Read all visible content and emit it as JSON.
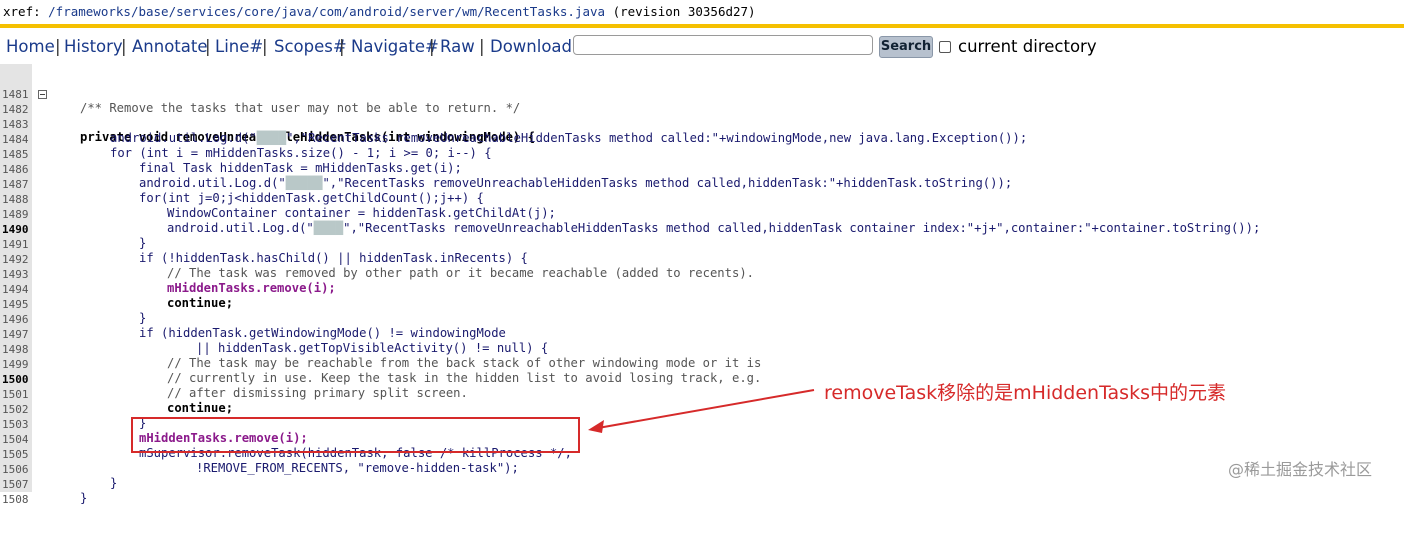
{
  "xref": {
    "prefix": "xref: ",
    "path": "/frameworks/base/services/core/java/com/android/server/wm/RecentTasks.java",
    "revision": " (revision 30356d27)"
  },
  "nav": {
    "items": [
      "Home",
      "History",
      "Annotate",
      "Line#",
      "Scopes#",
      "Navigate#",
      "Raw",
      "Download"
    ],
    "search_placeholder": "",
    "search_button": "Search",
    "checkbox_label": "current directory"
  },
  "code": {
    "lines": [
      {
        "n": "1481",
        "t": "/** Remove the tasks that user may not be able to return. */"
      },
      {
        "n": "1482",
        "t": "private void removeUnreachableHiddenTasks(int windowingMode) {"
      },
      {
        "n": "1483",
        "t": "android.util.Log.d(\"",
        "t2": "\",\"RecentTasks removeUnreachableHiddenTasks method called:\"+windowingMode,new java.lang.Exception());"
      },
      {
        "n": "1484",
        "t": "for (int i = mHiddenTasks.size() - 1; i >= 0; i--) {"
      },
      {
        "n": "1485",
        "t": "final Task hiddenTask = mHiddenTasks.get(i);"
      },
      {
        "n": "1486",
        "t": "android.util.Log.d(\"",
        "t2": "\",\"RecentTasks removeUnreachableHiddenTasks method called,hiddenTask:\"+hiddenTask.toString());"
      },
      {
        "n": "1487",
        "t": "for(int j=0;j<hiddenTask.getChildCount();j++) {"
      },
      {
        "n": "1488",
        "t": "WindowContainer container = hiddenTask.getChildAt(j);"
      },
      {
        "n": "1489",
        "t": "android.util.Log.d(\"",
        "t2": "\",\"RecentTasks removeUnreachableHiddenTasks method called,hiddenTask container index:\"+j+\",container:\"+container.toString());"
      },
      {
        "n": "1490",
        "t": "}"
      },
      {
        "n": "1491",
        "t": "if (!hiddenTask.hasChild() || hiddenTask.inRecents) {"
      },
      {
        "n": "1492",
        "t": "// The task was removed by other path or it became reachable (added to recents)."
      },
      {
        "n": "1493",
        "t": "mHiddenTasks.remove(i);"
      },
      {
        "n": "1494",
        "t": "continue;"
      },
      {
        "n": "1495",
        "t": "}"
      },
      {
        "n": "1496",
        "t": "if (hiddenTask.getWindowingMode() != windowingMode"
      },
      {
        "n": "1497",
        "t": "|| hiddenTask.getTopVisibleActivity() != null) {"
      },
      {
        "n": "1498",
        "t": "// The task may be reachable from the back stack of other windowing mode or it is"
      },
      {
        "n": "1499",
        "t": "// currently in use. Keep the task in the hidden list to avoid losing track, e.g."
      },
      {
        "n": "1500",
        "t": "// after dismissing primary split screen."
      },
      {
        "n": "1501",
        "t": "continue;"
      },
      {
        "n": "1502",
        "t": "}"
      },
      {
        "n": "1503",
        "t": "mHiddenTasks.remove(i);"
      },
      {
        "n": "1504",
        "t": "mSupervisor.removeTask(hiddenTask, false /* killProcess */,"
      },
      {
        "n": "1505",
        "t": "!REMOVE_FROM_RECENTS, \"remove-hidden-task\");"
      },
      {
        "n": "1506",
        "t": "}"
      },
      {
        "n": "1507",
        "t": "}"
      },
      {
        "n": "1508",
        "t": ""
      }
    ]
  },
  "annotation": "removeTask移除的是mHiddenTasks中的元素",
  "watermark": "@稀土掘金技术社区",
  "colors": {
    "accent_bar": "#f5c000",
    "annotation": "#d62a2a",
    "link": "#1a3a8a"
  }
}
